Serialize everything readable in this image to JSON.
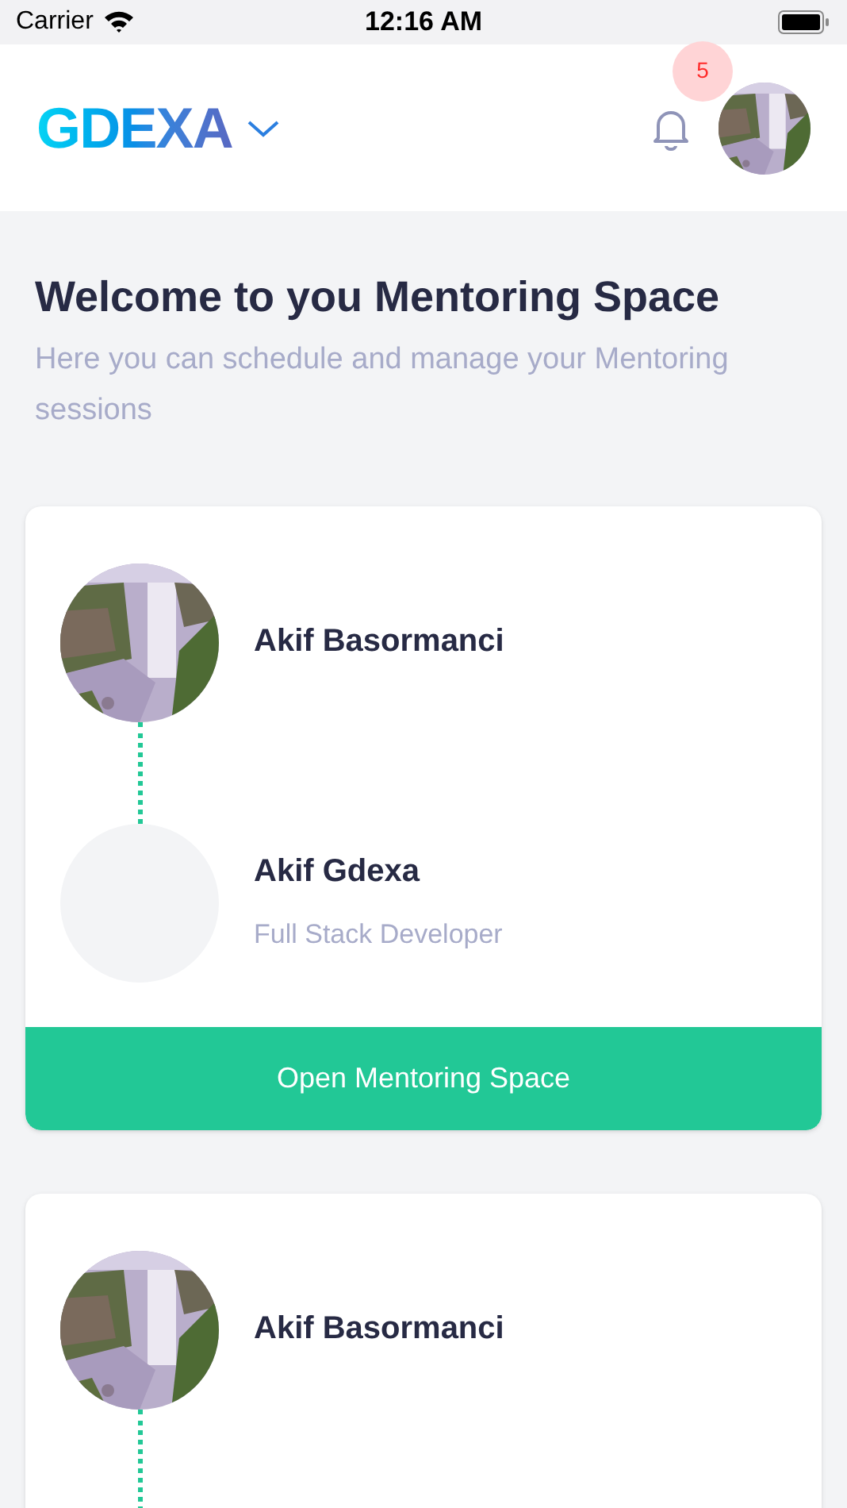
{
  "status_bar": {
    "carrier": "Carrier",
    "time": "12:16 AM"
  },
  "header": {
    "logo": "GDEXA",
    "notifications": {
      "count": "5"
    }
  },
  "intro": {
    "title": "Welcome to you Mentoring Space",
    "subtitle": "Here you can schedule and manage your Mentoring sessions"
  },
  "cards": [
    {
      "people": [
        {
          "name": "Akif Basormanci"
        },
        {
          "name": "Akif Gdexa",
          "role": "Full Stack Developer",
          "kind": "empty"
        }
      ],
      "button": "Open Mentoring Space"
    },
    {
      "people": [
        {
          "name": "Akif Basormanci"
        }
      ]
    }
  ]
}
